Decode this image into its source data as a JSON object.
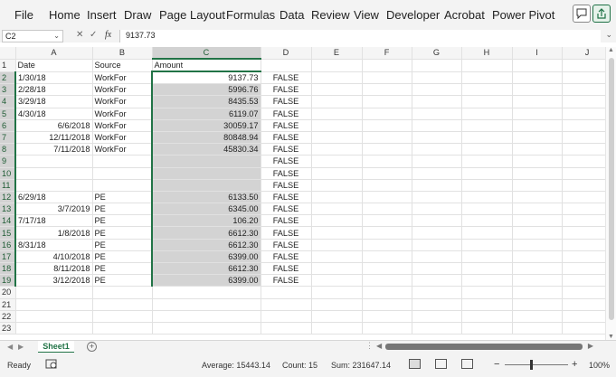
{
  "ribbon": {
    "tabs": [
      "File",
      "Home",
      "Insert",
      "Draw",
      "Page Layout",
      "Formulas",
      "Data",
      "Review",
      "View",
      "Developer",
      "Acrobat",
      "Power Pivot"
    ],
    "comments_icon": "comment-icon",
    "share_icon": "share-icon"
  },
  "formula_bar": {
    "name_box": "C2",
    "cancel_glyph": "✕",
    "enter_glyph": "✓",
    "fx_label": "fx",
    "formula": "9137.73"
  },
  "sheet": {
    "columns": [
      "A",
      "B",
      "C",
      "D",
      "E",
      "F",
      "G",
      "H",
      "I",
      "J"
    ],
    "rows": [
      {
        "n": "1",
        "a": "Date",
        "b": "Source",
        "c": "Amount",
        "d": ""
      },
      {
        "n": "2",
        "a": "1/30/18",
        "b": "WorkFor",
        "c": "9137.73",
        "d": "FALSE"
      },
      {
        "n": "3",
        "a": "2/28/18",
        "b": "WorkFor",
        "c": "5996.76",
        "d": "FALSE"
      },
      {
        "n": "4",
        "a": "3/29/18",
        "b": "WorkFor",
        "c": "8435.53",
        "d": "FALSE"
      },
      {
        "n": "5",
        "a": "4/30/18",
        "b": "WorkFor",
        "c": "6119.07",
        "d": "FALSE"
      },
      {
        "n": "6",
        "a": "6/6/2018",
        "b": "WorkFor",
        "c": "30059.17",
        "d": "FALSE"
      },
      {
        "n": "7",
        "a": "12/11/2018",
        "b": "WorkFor",
        "c": "80848.94",
        "d": "FALSE"
      },
      {
        "n": "8",
        "a": "7/11/2018",
        "b": "WorkFor",
        "c": "45830.34",
        "d": "FALSE"
      },
      {
        "n": "9",
        "a": "",
        "b": "",
        "c": "",
        "d": "FALSE"
      },
      {
        "n": "10",
        "a": "",
        "b": "",
        "c": "",
        "d": "FALSE"
      },
      {
        "n": "11",
        "a": "",
        "b": "",
        "c": "",
        "d": "FALSE"
      },
      {
        "n": "12",
        "a": "6/29/18",
        "b": "PE",
        "c": "6133.50",
        "d": "FALSE"
      },
      {
        "n": "13",
        "a": "3/7/2019",
        "b": "PE",
        "c": "6345.00",
        "d": "FALSE"
      },
      {
        "n": "14",
        "a": "7/17/18",
        "b": "PE",
        "c": "106.20",
        "d": "FALSE"
      },
      {
        "n": "15",
        "a": "1/8/2018",
        "b": "PE",
        "c": "6612.30",
        "d": "FALSE"
      },
      {
        "n": "16",
        "a": "8/31/18",
        "b": "PE",
        "c": "6612.30",
        "d": "FALSE"
      },
      {
        "n": "17",
        "a": "4/10/2018",
        "b": "PE",
        "c": "6399.00",
        "d": "FALSE"
      },
      {
        "n": "18",
        "a": "8/11/2018",
        "b": "PE",
        "c": "6612.30",
        "d": "FALSE"
      },
      {
        "n": "19",
        "a": "3/12/2018",
        "b": "PE",
        "c": "6399.00",
        "d": "FALSE"
      },
      {
        "n": "20",
        "a": "",
        "b": "",
        "c": "",
        "d": ""
      },
      {
        "n": "21",
        "a": "",
        "b": "",
        "c": "",
        "d": ""
      },
      {
        "n": "22",
        "a": "",
        "b": "",
        "c": "",
        "d": ""
      },
      {
        "n": "23",
        "a": "",
        "b": "",
        "c": "",
        "d": ""
      }
    ]
  },
  "sheet_tabs": {
    "prev": "◀",
    "next": "▶",
    "active": "Sheet1",
    "add": "+",
    "more": "⋮"
  },
  "status_bar": {
    "ready": "Ready",
    "average": "Average: 15443.14",
    "count": "Count: 15",
    "sum": "Sum: 231647.14",
    "zoom_minus": "−",
    "zoom_plus": "+",
    "zoom": "100%"
  },
  "colors": {
    "accent": "#217346",
    "selection_fill": "#d3d3d3"
  }
}
